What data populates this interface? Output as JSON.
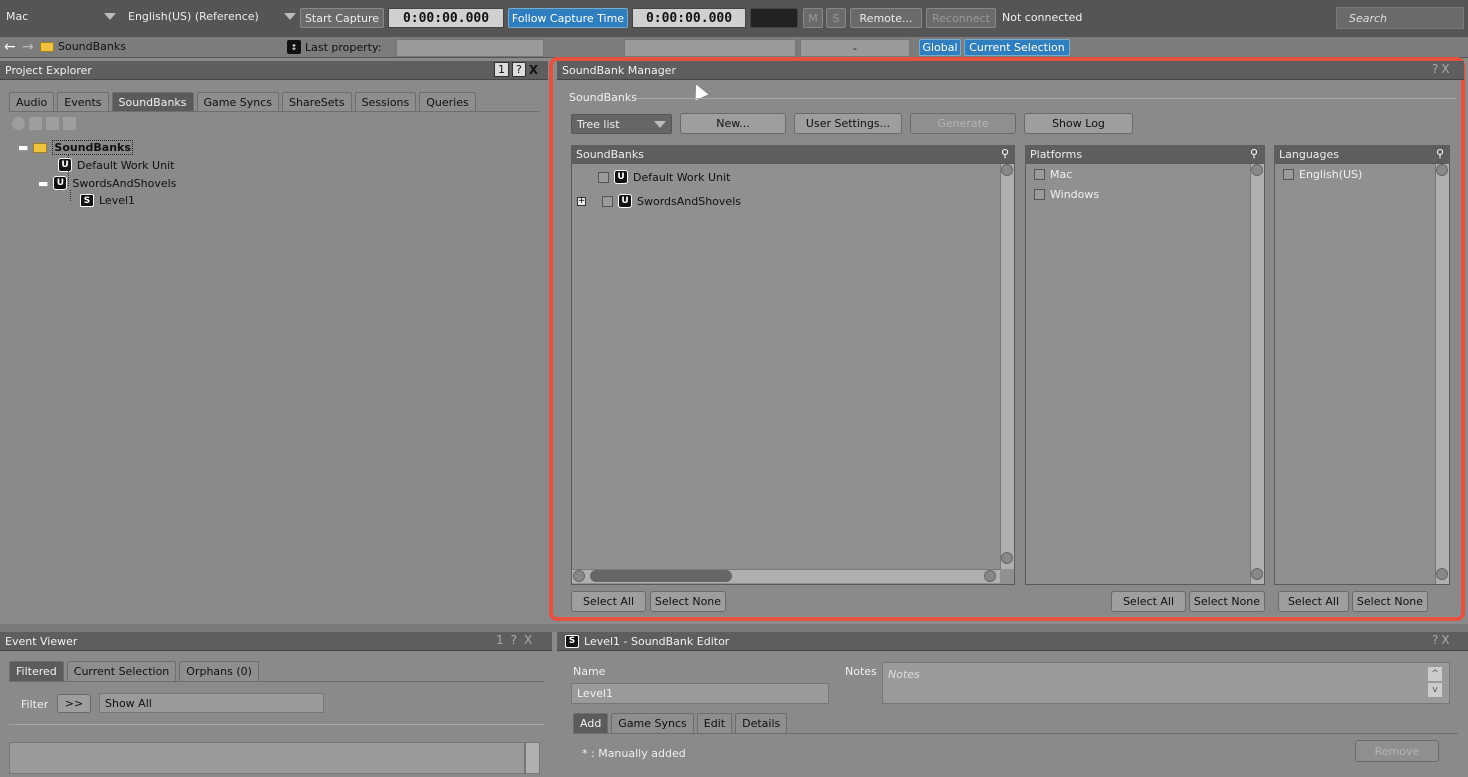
{
  "toolbar": {
    "platform": "Mac",
    "language": "English(US) (Reference)",
    "start_capture": "Start Capture",
    "capture_time": "0:00:00.000",
    "follow_capture_time": "Follow Capture Time",
    "follow_time": "0:00:00.000",
    "mute": "M",
    "solo": "S",
    "remote": "Remote...",
    "reconnect": "Reconnect",
    "status": "Not connected",
    "search": "Search"
  },
  "toolbar2": {
    "path": "SoundBanks",
    "last_property_label": "Last property:",
    "dash": "-",
    "global": "Global",
    "current_selection": "Current Selection"
  },
  "project_explorer": {
    "title": "Project Explorer",
    "controls": [
      "1",
      "?",
      "X"
    ],
    "tabs": [
      "Audio",
      "Events",
      "SoundBanks",
      "Game Syncs",
      "ShareSets",
      "Sessions",
      "Queries"
    ],
    "active_tab": "SoundBanks",
    "tree": {
      "root": "SoundBanks",
      "items": [
        "Default Work Unit",
        "SwordsAndShovels"
      ],
      "child": "Level1"
    }
  },
  "soundbank_manager": {
    "title": "SoundBank Manager",
    "controls": [
      "?",
      "X"
    ],
    "group_label": "SoundBanks",
    "view_mode": "Tree list",
    "new_btn": "New...",
    "user_settings_btn": "User Settings...",
    "generate_btn": "Generate",
    "show_log_btn": "Show Log",
    "soundbanks_header": "SoundBanks",
    "soundbanks": [
      "Default Work Unit",
      "SwordsAndShovels"
    ],
    "platforms_header": "Platforms",
    "platforms": [
      "Mac",
      "Windows"
    ],
    "languages_header": "Languages",
    "languages": [
      "English(US)"
    ],
    "select_all": "Select All",
    "select_none": "Select None"
  },
  "event_viewer": {
    "title": "Event Viewer",
    "controls": [
      "1",
      "?",
      "X"
    ],
    "tabs": [
      "Filtered",
      "Current Selection",
      "Orphans (0)"
    ],
    "active_tab": "Filtered",
    "filter_label": "Filter",
    "filter_btn": ">>",
    "filter_value": "Show All"
  },
  "soundbank_editor": {
    "title": "Level1 - SoundBank Editor",
    "controls": [
      "?",
      "X"
    ],
    "name_label": "Name",
    "name_value": "Level1",
    "notes_label": "Notes",
    "notes_placeholder": "Notes",
    "tabs": [
      "Add",
      "Game Syncs",
      "Edit",
      "Details"
    ],
    "active_tab": "Add",
    "manual_note": "* : Manually added",
    "remove_btn": "Remove"
  },
  "colors": {
    "highlight_border": "#e8513f",
    "accent_blue": "#2f7fc0"
  }
}
